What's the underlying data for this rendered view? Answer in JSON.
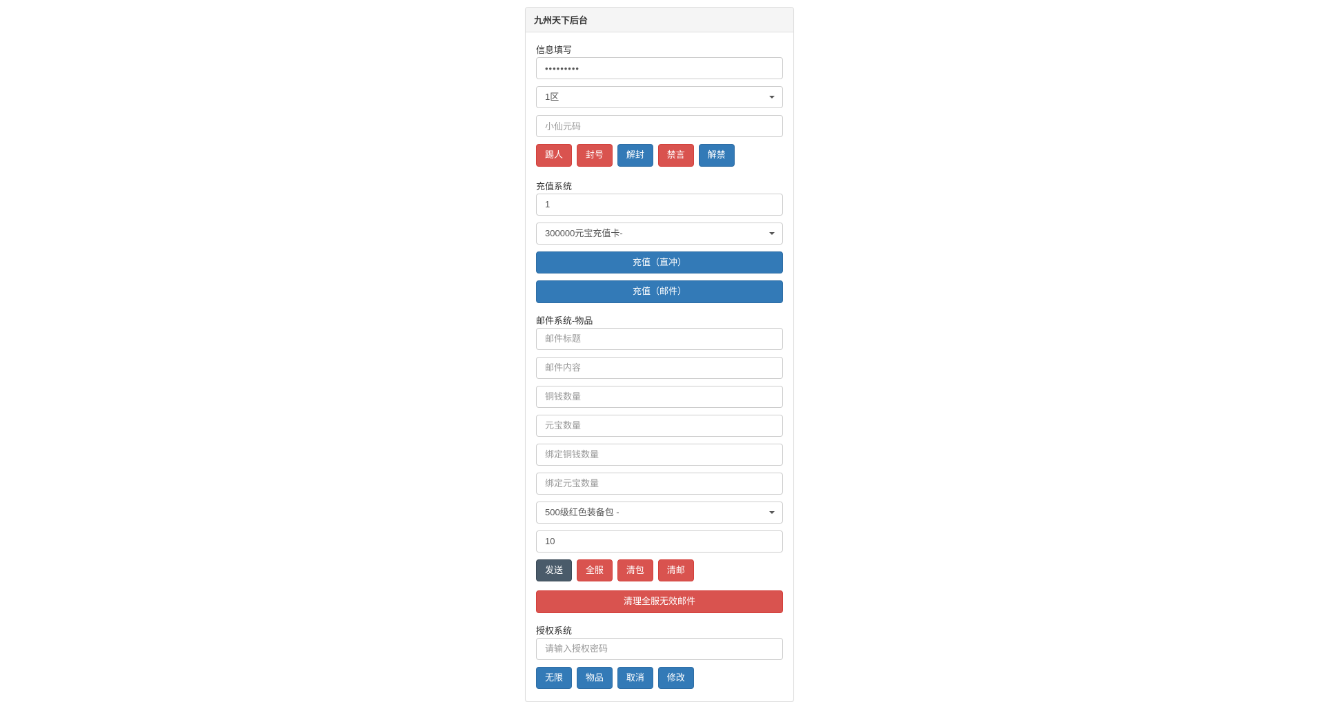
{
  "panel": {
    "title": "九州天下后台"
  },
  "info": {
    "section_label": "信息填写",
    "password_value": "•••••••••",
    "zone_selected": "1区",
    "player_placeholder": "小仙元码",
    "buttons": {
      "kick": "踢人",
      "ban_account": "封号",
      "unban": "解封",
      "mute": "禁言",
      "unmute": "解禁"
    }
  },
  "recharge": {
    "section_label": "充值系统",
    "amount_value": "1",
    "card_selected": "300000元宝充值卡-",
    "buttons": {
      "direct": "充值（直冲）",
      "mail": "充值（邮件）"
    }
  },
  "mail": {
    "section_label": "邮件系统-物品",
    "title_placeholder": "邮件标题",
    "content_placeholder": "邮件内容",
    "copper_placeholder": "铜钱数量",
    "gold_placeholder": "元宝数量",
    "bound_copper_placeholder": "绑定铜钱数量",
    "bound_gold_placeholder": "绑定元宝数量",
    "item_selected": "500级红色装备包 -",
    "qty_value": "10",
    "buttons": {
      "send": "发送",
      "all_server": "全服",
      "clear_bag": "清包",
      "clear_mail": "清邮",
      "clear_invalid": "清理全服无效邮件"
    }
  },
  "auth": {
    "section_label": "授权系统",
    "password_placeholder": "请输入授权密码",
    "buttons": {
      "unlimited": "无限",
      "items": "物品",
      "cancel": "取消",
      "modify": "修改"
    }
  }
}
